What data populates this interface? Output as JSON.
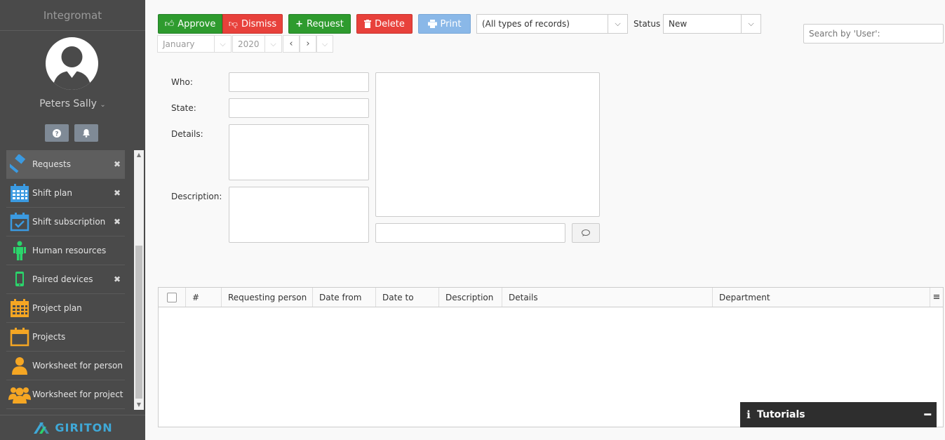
{
  "sidebar": {
    "title": "Integromat",
    "user_name": "Peters Sally",
    "menu": [
      {
        "label": "Requests",
        "icon": "hammer-icon",
        "closable": true,
        "active": true
      },
      {
        "label": "Shift plan",
        "icon": "calendar-grid-icon",
        "closable": true
      },
      {
        "label": "Shift subscription",
        "icon": "calendar-check-icon",
        "closable": true
      },
      {
        "label": "Human resources",
        "icon": "person-icon",
        "closable": false
      },
      {
        "label": "Paired devices",
        "icon": "phone-icon",
        "closable": true
      },
      {
        "label": "Project plan",
        "icon": "calendar-grid-icon",
        "closable": false
      },
      {
        "label": "Projects",
        "icon": "calendar-icon",
        "closable": false
      },
      {
        "label": "Worksheet for person",
        "icon": "user-icon",
        "closable": false
      },
      {
        "label": "Worksheet for project",
        "icon": "users-icon",
        "closable": false
      }
    ],
    "brand": "GIRITON"
  },
  "toolbar": {
    "approve": "Approve",
    "dismiss": "Dismiss",
    "request": "Request",
    "delete": "Delete",
    "print": "Print",
    "record_type": "(All types of records)",
    "status_label": "Status",
    "status_value": "New",
    "search_placeholder": "Search by 'User':"
  },
  "navigator": {
    "month": "January",
    "year": "2020"
  },
  "form": {
    "who": "Who:",
    "state": "State:",
    "details": "Details:",
    "description": "Description:"
  },
  "grid": {
    "columns": [
      "#",
      "Requesting person",
      "Date from",
      "Date to",
      "Description",
      "Details",
      "Department"
    ]
  },
  "tutorials": {
    "label": "Tutorials"
  },
  "colors": {
    "sidebar_bg": "#4a4a4a",
    "green": "#2e9b2e",
    "red": "#e8413b",
    "blue_light": "#8ab8e8",
    "brand": "#3fa9d8"
  }
}
